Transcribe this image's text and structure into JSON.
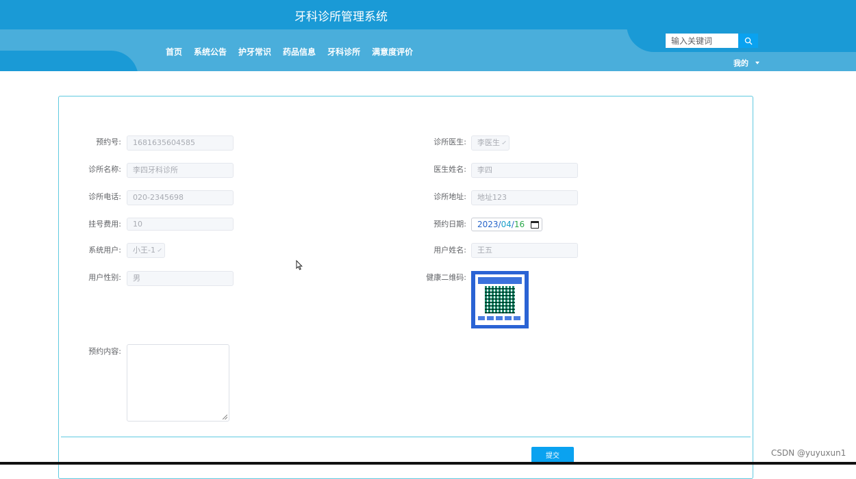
{
  "header": {
    "site_title": "牙科诊所管理系统",
    "nav": [
      "首页",
      "系统公告",
      "护牙常识",
      "药品信息",
      "牙科诊所",
      "满意度评价"
    ],
    "search_placeholder": "输入关键词",
    "user_menu": "我的"
  },
  "form": {
    "fields": [
      {
        "label": "预约号:",
        "value": "1681635604585"
      },
      {
        "label": "诊所医生:",
        "value": "李医生"
      },
      {
        "label": "诊所名称:",
        "value": "李四牙科诊所"
      },
      {
        "label": "医生姓名:",
        "value": "李四"
      },
      {
        "label": "诊所电话:",
        "value": "020-2345698"
      },
      {
        "label": "诊所地址:",
        "value": "地址123"
      },
      {
        "label": "挂号费用:",
        "value": "10"
      },
      {
        "label": "预约日期:",
        "year": "2023",
        "month": "04",
        "day": "16"
      },
      {
        "label": "系统用户:",
        "value": "小王-1"
      },
      {
        "label": "用户姓名:",
        "value": "王五"
      },
      {
        "label": "用户性别:",
        "value": "男"
      },
      {
        "label": "健康二维码:"
      },
      {
        "label": "预约内容:",
        "value": ""
      }
    ],
    "submit_label": "提交"
  },
  "watermark": "CSDN @yuyuxun1",
  "colors": {
    "primary": "#1a9ad6",
    "band": "#4aaedb",
    "button": "#0aa2f0",
    "panel_border": "#5fc9e0"
  }
}
